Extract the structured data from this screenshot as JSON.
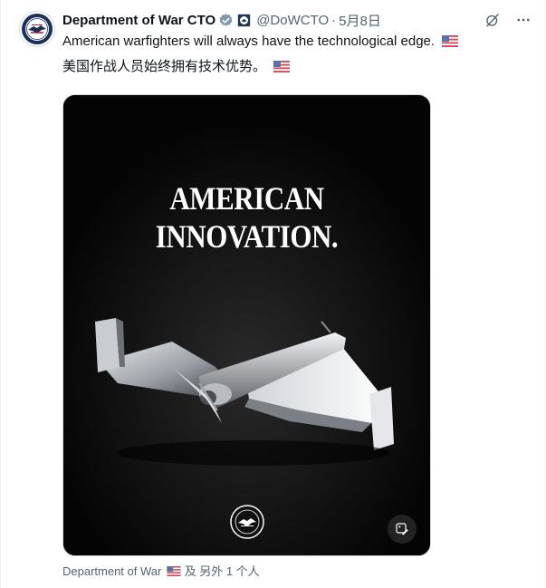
{
  "author": {
    "display_name": "Department of War CTO",
    "handle": "@DoWCTO",
    "separator": "·",
    "date": "5月8日",
    "verified_color": "#829aab"
  },
  "tweet": {
    "line1": "American warfighters will always have the technological edge.",
    "line2": "美国作战人员始终拥有技术优势。",
    "flag_icon": "us-flag-icon"
  },
  "media": {
    "headline": "AMERICAN INNOVATION.",
    "background": "#050505"
  },
  "tagged": {
    "name": "Department of War",
    "suffix": "及 另外 1 个人"
  },
  "icons": {
    "grok": "grok-icon",
    "more": "more-icon",
    "edit": "edit-image-icon"
  }
}
